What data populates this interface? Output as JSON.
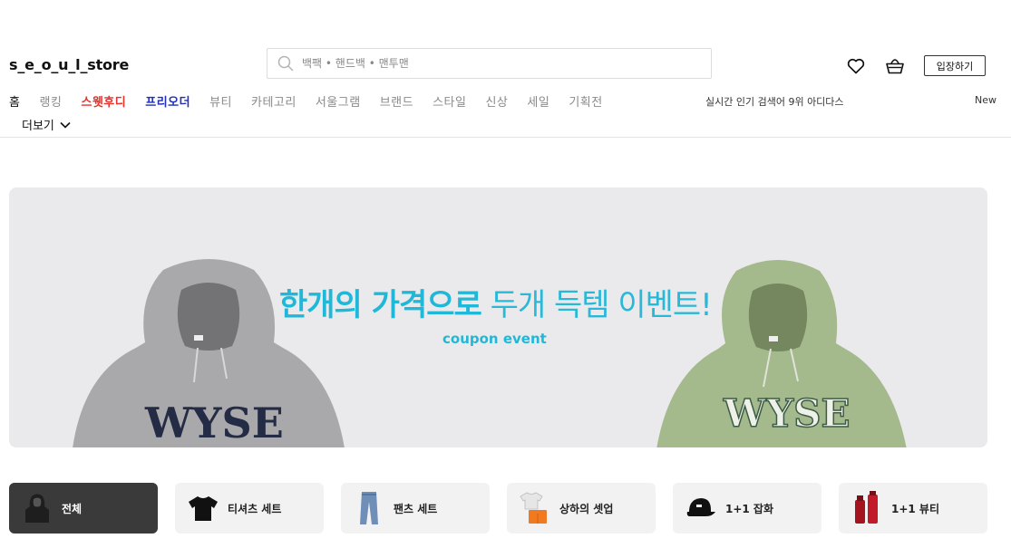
{
  "header": {
    "logo": "s_e_o_u_l_store",
    "search_placeholder": "백팩 • 핸드백 • 맨투맨",
    "login_label": "입장하기"
  },
  "nav": {
    "items": [
      {
        "label": "홈",
        "style": "active"
      },
      {
        "label": "랭킹",
        "style": "normal"
      },
      {
        "label": "스웻후디",
        "style": "red"
      },
      {
        "label": "프리오더",
        "style": "blue"
      },
      {
        "label": "뷰티",
        "style": "normal"
      },
      {
        "label": "카테고리",
        "style": "normal"
      },
      {
        "label": "서울그램",
        "style": "normal"
      },
      {
        "label": "브랜드",
        "style": "normal"
      },
      {
        "label": "스타일",
        "style": "normal"
      },
      {
        "label": "신상",
        "style": "normal"
      },
      {
        "label": "세일",
        "style": "normal"
      },
      {
        "label": "기획전",
        "style": "normal"
      }
    ],
    "realtime": "실시간 인기 검색어 9위 아디다스",
    "new_label": "New",
    "more_label": "더보기"
  },
  "banner": {
    "title_strong": "한개의 가격으로",
    "title_light": " 두개 득템 이벤트!",
    "subtitle": "coupon event",
    "hoodie_text": "WYSE"
  },
  "categories": [
    {
      "label": "전체",
      "active": true
    },
    {
      "label": "티셔츠 세트",
      "active": false
    },
    {
      "label": "팬츠 세트",
      "active": false
    },
    {
      "label": "상하의 셋업",
      "active": false
    },
    {
      "label": "1+1 잡화",
      "active": false
    },
    {
      "label": "1+1 뷰티",
      "active": false
    }
  ],
  "colors": {
    "accent_cyan": "#1fb8d8",
    "nav_red": "#e5322d",
    "nav_blue": "#1f2fb8"
  }
}
